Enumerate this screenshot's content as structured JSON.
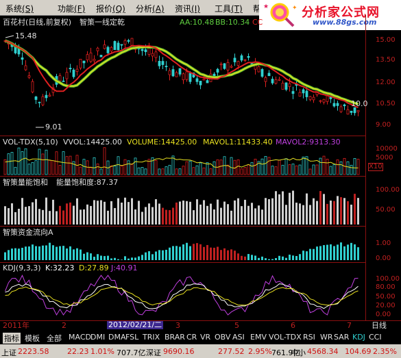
{
  "menu": [
    {
      "label": "系统",
      "hotkey": "(S)"
    },
    {
      "label": "功能",
      "hotkey": "(F)"
    },
    {
      "label": "报价",
      "hotkey": "(Q)"
    },
    {
      "label": "分析",
      "hotkey": "(A)"
    },
    {
      "label": "资讯",
      "hotkey": "(I)"
    },
    {
      "label": "工具",
      "hotkey": "(T)"
    },
    {
      "label": "帮助",
      "hotkey": ""
    }
  ],
  "logo": {
    "main": "分析家公式网",
    "url": "www.88gs.com"
  },
  "main_panel": {
    "title": "百花村(日线,前复权)",
    "indicator": "智策一线定乾",
    "aa": "AA:10.48",
    "bb": "BB:10.34",
    "cc": "CC",
    "high_label": "15.48",
    "low_label": "9.01",
    "last_label": "10.0"
  },
  "vol_panel": {
    "name": "VOL-TDX(5,10)",
    "vvol": "VVOL:14425.00",
    "volume": "VOLUME:14425.00",
    "mavol1": "MAVOL1:11433.40",
    "mavol2": "MAVOL2:9313.30",
    "unit": "X10"
  },
  "sat_panel": {
    "name": "智策量能饱和",
    "value": "能量饱和度:87.37"
  },
  "flow_panel": {
    "name": "智策资金流向A"
  },
  "kdj_panel": {
    "name": "KDJ(9,3,3)",
    "k": "K:32.23",
    "d": "D:27.89",
    "j": "J:40.91"
  },
  "axis": {
    "price": [
      "15.00",
      "13.50",
      "12.00",
      "10.50",
      "9.00"
    ],
    "vol": [
      "10000",
      "5000"
    ],
    "sat": [
      "100.00",
      "50.00"
    ],
    "flow": [
      "1.00",
      "0.00"
    ],
    "kdj": [
      "100.00",
      "80.00",
      "50.00",
      "20.00",
      "0.00"
    ]
  },
  "dates": {
    "year": "2011年",
    "m2": "2",
    "selected": "2012/02/21/二",
    "m3": "3",
    "m4": "4",
    "m5": "5",
    "m6": "6",
    "m7": "7",
    "period": "日线"
  },
  "tabs": [
    "指标",
    "模板",
    "全部",
    "MACD",
    "DMI",
    "DMA",
    "FSL",
    "TRIX",
    "BRAR",
    "CR",
    "VR",
    "OBV",
    "ASI",
    "EMV",
    "VOL-TDX",
    "RSI",
    "WR",
    "SAR",
    "KDJ",
    "CCI"
  ],
  "status": {
    "sh_label": "上证",
    "sh_val": "2223.58",
    "sh_chg": "22.23",
    "sh_pct": "1.01%",
    "sh_amt": "707.7亿",
    "sz_label": "深证",
    "sz_val": "9690.16",
    "sz_chg": "277.52",
    "sz_pct": "2.95%",
    "sz_amt": "761.9亿",
    "zx_label": "中小",
    "zx_val": "4568.34",
    "zx_chg": "104.69",
    "zx_pct": "2.35%"
  },
  "colors": {
    "up": "#e02020",
    "down": "#30d0d0",
    "ma_red": "#e02020",
    "ma_green": "#60c030",
    "ma_yellow": "#e8e020",
    "kdj_k": "#ffffff",
    "kdj_d": "#e8e020",
    "kdj_j": "#c040e0"
  }
}
